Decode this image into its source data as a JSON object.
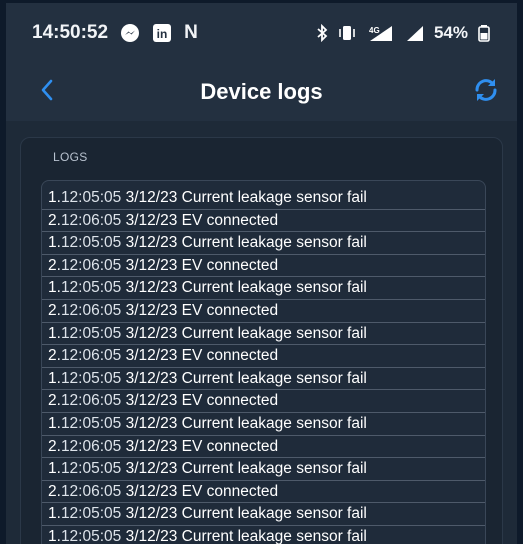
{
  "status_bar": {
    "time": "14:50:52",
    "app_icon_letter": "N",
    "linkedin_label": "in",
    "network": "4G",
    "battery": "54%"
  },
  "header": {
    "title": "Device logs",
    "back_icon": "chevron-left-icon",
    "refresh_icon": "refresh-icon"
  },
  "logs": {
    "label": "LOGS",
    "entries": [
      {
        "index": "1.",
        "time": "12:05:05",
        "date": "3/12/23",
        "message": "Current leakage sensor fail"
      },
      {
        "index": "2.",
        "time": "12:06:05",
        "date": "3/12/23",
        "message": "EV connected"
      },
      {
        "index": "1.",
        "time": "12:05:05",
        "date": "3/12/23",
        "message": "Current leakage sensor fail"
      },
      {
        "index": "2.",
        "time": "12:06:05",
        "date": "3/12/23",
        "message": "EV connected"
      },
      {
        "index": "1.",
        "time": "12:05:05",
        "date": "3/12/23",
        "message": "Current leakage sensor fail"
      },
      {
        "index": "2.",
        "time": "12:06:05",
        "date": "3/12/23",
        "message": "EV connected"
      },
      {
        "index": "1.",
        "time": "12:05:05",
        "date": "3/12/23",
        "message": "Current leakage sensor fail"
      },
      {
        "index": "2.",
        "time": "12:06:05",
        "date": "3/12/23",
        "message": "EV connected"
      },
      {
        "index": "1.",
        "time": "12:05:05",
        "date": "3/12/23",
        "message": "Current leakage sensor fail"
      },
      {
        "index": "2.",
        "time": "12:06:05",
        "date": "3/12/23",
        "message": "EV connected"
      },
      {
        "index": "1.",
        "time": "12:05:05",
        "date": "3/12/23",
        "message": "Current leakage sensor fail"
      },
      {
        "index": "2.",
        "time": "12:06:05",
        "date": "3/12/23",
        "message": "EV connected"
      },
      {
        "index": "1.",
        "time": "12:05:05",
        "date": "3/12/23",
        "message": "Current leakage sensor fail"
      },
      {
        "index": "2.",
        "time": "12:06:05",
        "date": "3/12/23",
        "message": "EV connected"
      },
      {
        "index": "1.",
        "time": "12:05:05",
        "date": "3/12/23",
        "message": "Current leakage sensor fail"
      },
      {
        "index": "1.",
        "time": "12:05:05",
        "date": "3/12/23",
        "message": "Current leakage sensor fail"
      }
    ]
  },
  "colors": {
    "accent": "#2f8ff0",
    "background": "#1e2a38",
    "text": "#ffffff"
  }
}
